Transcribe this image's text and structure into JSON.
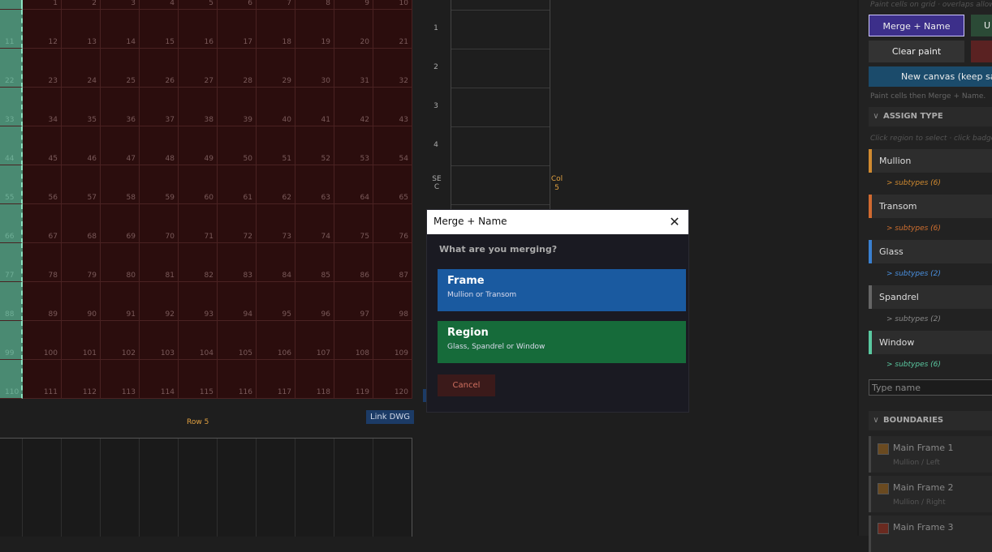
{
  "grid": {
    "header_numbers": [
      "1",
      "2",
      "3",
      "4",
      "5",
      "6",
      "7",
      "8",
      "9",
      "10"
    ],
    "rows": [
      [
        "11",
        "12",
        "13",
        "14",
        "15",
        "16",
        "17",
        "18",
        "19",
        "20",
        "21"
      ],
      [
        "22",
        "23",
        "24",
        "25",
        "26",
        "27",
        "28",
        "29",
        "30",
        "31",
        "32"
      ],
      [
        "33",
        "34",
        "35",
        "36",
        "37",
        "38",
        "39",
        "40",
        "41",
        "42",
        "43"
      ],
      [
        "44",
        "45",
        "46",
        "47",
        "48",
        "49",
        "50",
        "51",
        "52",
        "53",
        "54"
      ],
      [
        "55",
        "56",
        "57",
        "58",
        "59",
        "60",
        "61",
        "62",
        "63",
        "64",
        "65"
      ],
      [
        "66",
        "67",
        "68",
        "69",
        "70",
        "71",
        "72",
        "73",
        "74",
        "75",
        "76"
      ],
      [
        "77",
        "78",
        "79",
        "80",
        "81",
        "82",
        "83",
        "84",
        "85",
        "86",
        "87"
      ],
      [
        "88",
        "89",
        "90",
        "91",
        "92",
        "93",
        "94",
        "95",
        "96",
        "97",
        "98"
      ],
      [
        "99",
        "100",
        "101",
        "102",
        "103",
        "104",
        "105",
        "106",
        "107",
        "108",
        "109"
      ],
      [
        "110",
        "111",
        "112",
        "113",
        "114",
        "115",
        "116",
        "117",
        "118",
        "119",
        "120"
      ]
    ],
    "row_label": "Row 5",
    "link_dwg_label": "Link DWG"
  },
  "section": {
    "row_numbers": [
      "1",
      "2",
      "3",
      "4"
    ],
    "sec_label": "SE C",
    "col_label": "Col 5"
  },
  "dialog": {
    "title": "Merge + Name",
    "close_glyph": "✕",
    "question": "What are you merging?",
    "options": [
      {
        "title": "Frame",
        "desc": "Mullion or Transom",
        "color": "#1a5aa0"
      },
      {
        "title": "Region",
        "desc": "Glass, Spandrel or Window",
        "color": "#166b3a"
      }
    ],
    "cancel_label": "Cancel"
  },
  "panel": {
    "top_hint": "Paint cells on grid · overlaps allowed",
    "merge_button": "Merge + Name",
    "u_button": "U",
    "clear_button": "Clear paint",
    "new_canvas_button": "New canvas (keep saved)",
    "paint_hint": "Paint cells then Merge + Name.",
    "assign_header": "ASSIGN TYPE",
    "chevron": "∨",
    "assign_hint": "Click region to select · click badge or ...",
    "types": [
      {
        "name": "Mullion",
        "subtypes": "> subtypes (6)",
        "color": "#d08a30",
        "sub_color": "#d08a30"
      },
      {
        "name": "Transom",
        "subtypes": "> subtypes (6)",
        "color": "#d06a30",
        "sub_color": "#d07030"
      },
      {
        "name": "Glass",
        "subtypes": "> subtypes (2)",
        "color": "#3a80d0",
        "sub_color": "#4a90e0"
      },
      {
        "name": "Spandrel",
        "subtypes": "> subtypes (2)",
        "color": "#666666",
        "sub_color": "#888888"
      },
      {
        "name": "Window",
        "subtypes": "> subtypes (6)",
        "color": "#5ac8a0",
        "sub_color": "#5ac8a0"
      }
    ],
    "type_name_placeholder": "Type name",
    "boundaries_header": "BOUNDARIES",
    "boundaries": [
      {
        "name": "Main Frame 1",
        "sub": "Mullion / Left",
        "swatch": "#6a4a20"
      },
      {
        "name": "Main Frame 2",
        "sub": "Mullion / Right",
        "swatch": "#6a4a20"
      },
      {
        "name": "Main Frame 3",
        "sub": "",
        "swatch": "#6a2a20"
      }
    ]
  }
}
